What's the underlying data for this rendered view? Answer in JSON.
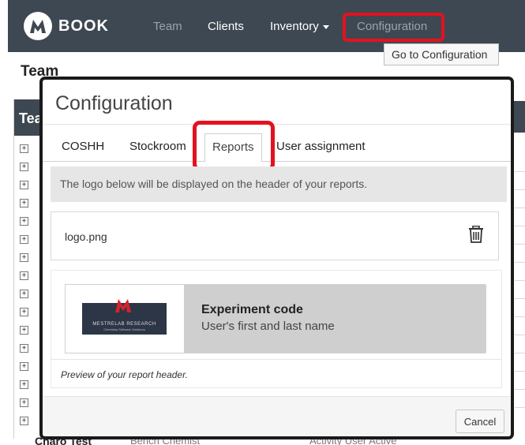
{
  "navbar": {
    "brand": "BOOK",
    "items": [
      {
        "label": "Team"
      },
      {
        "label": "Clients"
      },
      {
        "label": "Inventory"
      },
      {
        "label": "Configuration"
      }
    ],
    "tooltip": "Go to Configuration"
  },
  "background": {
    "page_title": "Team",
    "panel_title": "Tea",
    "footer_name": "Charo Test",
    "footer_role": "Bench Chemist",
    "footer_status": "Activity User Active"
  },
  "modal": {
    "title": "Configuration",
    "tabs": [
      {
        "label": "COSHH"
      },
      {
        "label": "Stockroom"
      },
      {
        "label": "Reports"
      },
      {
        "label": "User assignment"
      }
    ],
    "active_tab": "Reports",
    "info_text": "The logo below will be displayed on the header of your reports.",
    "file_name": "logo.png",
    "preview": {
      "logo_line1": "MESTRELAB RESEARCH",
      "logo_line2": "Chemistry Software Solutions",
      "experiment_code": "Experiment code",
      "user_name": "User's first and last name",
      "caption": "Preview of your report header."
    },
    "cancel_label": "Cancel"
  },
  "colors": {
    "navbar": "#3e4852",
    "highlight": "#e3121f",
    "logo_plate": "#2c3646",
    "logo_accent": "#d2232a"
  },
  "icons": {
    "brand": "m-logo-icon",
    "expand": "plus-square-icon",
    "delete": "trash-icon",
    "dropdown": "caret-down-icon"
  }
}
